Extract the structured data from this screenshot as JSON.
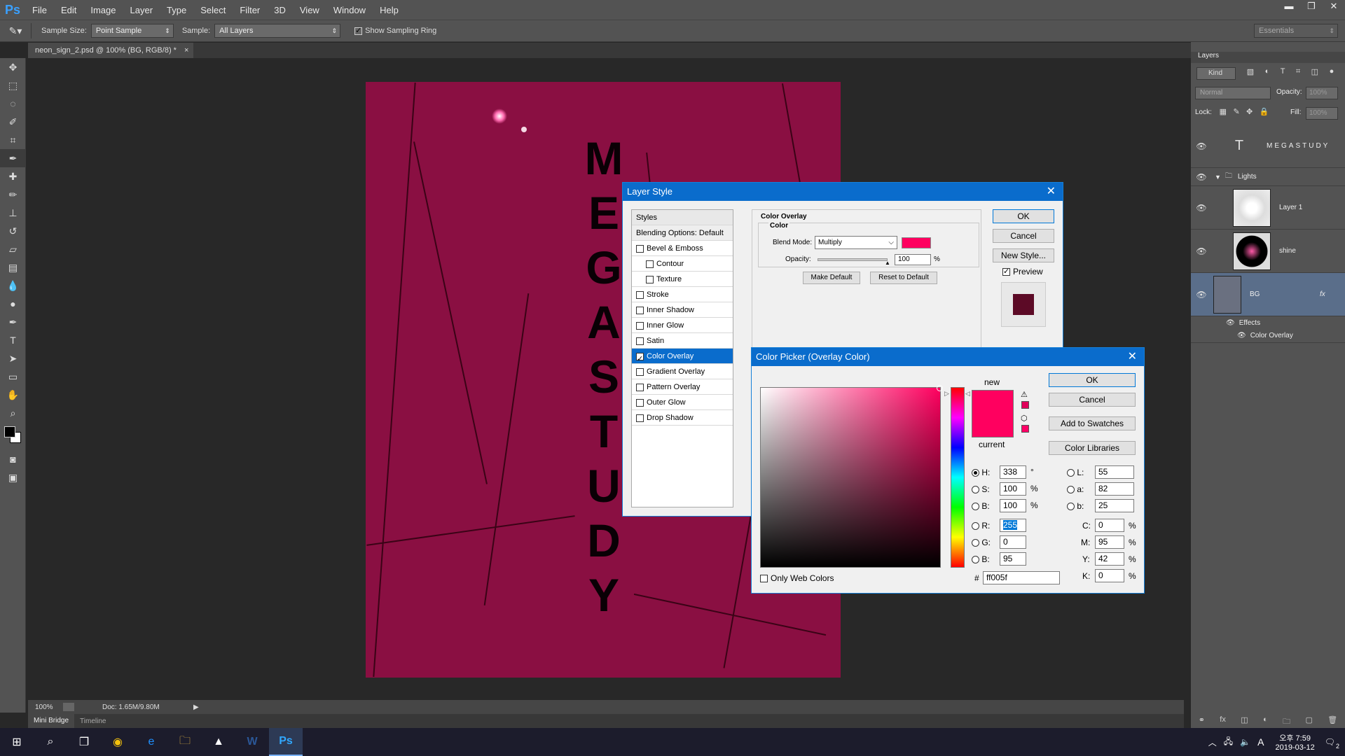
{
  "app": {
    "logo": "Ps"
  },
  "menu": [
    "File",
    "Edit",
    "Image",
    "Layer",
    "Type",
    "Select",
    "Filter",
    "3D",
    "View",
    "Window",
    "Help"
  ],
  "options": {
    "sample_size_label": "Sample Size:",
    "sample_size_value": "Point Sample",
    "sample_label": "Sample:",
    "sample_value": "All Layers",
    "show_ring": "Show Sampling Ring",
    "workspace": "Essentials"
  },
  "doc_tab": {
    "title": "neon_sign_2.psd @ 100% (BG, RGB/8) *",
    "close": "×"
  },
  "canvas": {
    "text_letters": [
      "M",
      "E",
      "G",
      "A",
      "S",
      "T",
      "U",
      "D",
      "Y"
    ],
    "bg_color": "#8a0f42"
  },
  "status": {
    "zoom": "100%",
    "doc": "Doc: 1.65M/9.80M"
  },
  "bottom_tabs": [
    "Mini Bridge",
    "Timeline"
  ],
  "layers_panel": {
    "title": "Layers",
    "kind": "Kind",
    "blend": "Normal",
    "opacity_label": "Opacity:",
    "opacity_value": "100%",
    "lock_label": "Lock:",
    "fill_label": "Fill:",
    "fill_value": "100%",
    "layers": [
      {
        "name": "MEGASTUDY",
        "type": "text"
      },
      {
        "name": "Lights",
        "type": "group"
      },
      {
        "name": "Layer 1",
        "type": "pixel"
      },
      {
        "name": "shine",
        "type": "pixel"
      },
      {
        "name": "BG",
        "type": "pixel",
        "fx": "fx"
      }
    ],
    "effects_label": "Effects",
    "effect_item": "Color Overlay"
  },
  "layer_style": {
    "title": "Layer Style",
    "styles_header": "Styles",
    "blending": "Blending Options: Default",
    "items": [
      {
        "label": "Bevel & Emboss",
        "checked": false,
        "sub": false
      },
      {
        "label": "Contour",
        "checked": false,
        "sub": true
      },
      {
        "label": "Texture",
        "checked": false,
        "sub": true
      },
      {
        "label": "Stroke",
        "checked": false,
        "sub": false
      },
      {
        "label": "Inner Shadow",
        "checked": false,
        "sub": false
      },
      {
        "label": "Inner Glow",
        "checked": false,
        "sub": false
      },
      {
        "label": "Satin",
        "checked": false,
        "sub": false
      },
      {
        "label": "Color Overlay",
        "checked": true,
        "sub": false,
        "active": true
      },
      {
        "label": "Gradient Overlay",
        "checked": false,
        "sub": false
      },
      {
        "label": "Pattern Overlay",
        "checked": false,
        "sub": false
      },
      {
        "label": "Outer Glow",
        "checked": false,
        "sub": false
      },
      {
        "label": "Drop Shadow",
        "checked": false,
        "sub": false
      }
    ],
    "section": "Color Overlay",
    "subsection": "Color",
    "blend_mode_label": "Blend Mode:",
    "blend_mode_value": "Multiply",
    "overlay_color": "#ff005f",
    "opacity_label": "Opacity:",
    "opacity_value": "100",
    "percent": "%",
    "make_default": "Make Default",
    "reset_default": "Reset to Default",
    "ok": "OK",
    "cancel": "Cancel",
    "new_style": "New Style...",
    "preview": "Preview",
    "preview_color": "#5c0a26"
  },
  "color_picker": {
    "title": "Color Picker (Overlay Color)",
    "new_label": "new",
    "current_label": "current",
    "new_color": "#ff005f",
    "ok": "OK",
    "cancel": "Cancel",
    "add_swatches": "Add to Swatches",
    "color_libraries": "Color Libraries",
    "fields": {
      "H": {
        "label": "H:",
        "value": "338",
        "unit": "°"
      },
      "S": {
        "label": "S:",
        "value": "100",
        "unit": "%"
      },
      "Bv": {
        "label": "B:",
        "value": "100",
        "unit": "%"
      },
      "R": {
        "label": "R:",
        "value": "255"
      },
      "G": {
        "label": "G:",
        "value": "0"
      },
      "Bc": {
        "label": "B:",
        "value": "95"
      },
      "L": {
        "label": "L:",
        "value": "55"
      },
      "a": {
        "label": "a:",
        "value": "82"
      },
      "b": {
        "label": "b:",
        "value": "25"
      },
      "C": {
        "label": "C:",
        "value": "0",
        "unit": "%"
      },
      "M": {
        "label": "M:",
        "value": "95",
        "unit": "%"
      },
      "Y": {
        "label": "Y:",
        "value": "42",
        "unit": "%"
      },
      "K": {
        "label": "K:",
        "value": "0",
        "unit": "%"
      }
    },
    "hash": "#",
    "hex": "ff005f",
    "only_web": "Only Web Colors"
  },
  "taskbar": {
    "time": "오후 7:59",
    "date": "2019-03-12",
    "ime": "A",
    "notif": "2"
  }
}
